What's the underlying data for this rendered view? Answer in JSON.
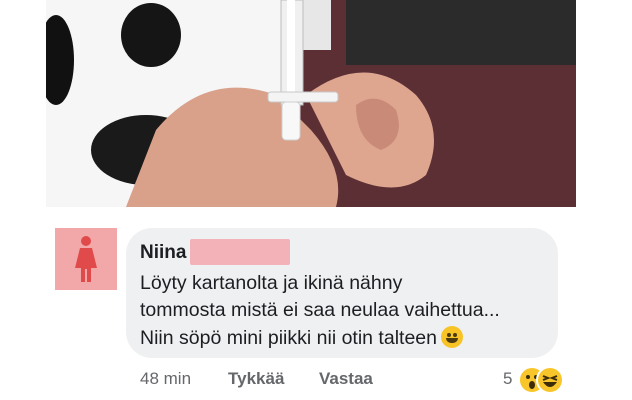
{
  "photo": {
    "icon": "syringe-photo"
  },
  "comment": {
    "author": "Niina",
    "lines": [
      "Löyty kartanolta ja ikinä nähny",
      "tommosta mistä ei saa neulaa vaihettua...",
      "Niin söpö mini piikki nii otin talteen"
    ],
    "emoji": "grinning-sweat-emoji"
  },
  "footer": {
    "time": "48 min",
    "like_label": "Tykkää",
    "reply_label": "Vastaa",
    "reaction_count": "5"
  },
  "colors": {
    "avatar_bg": "#f2a8a8",
    "bubble_bg": "#eff0f2",
    "redaction": "#f3b1b8",
    "meta_text": "#65676b"
  }
}
